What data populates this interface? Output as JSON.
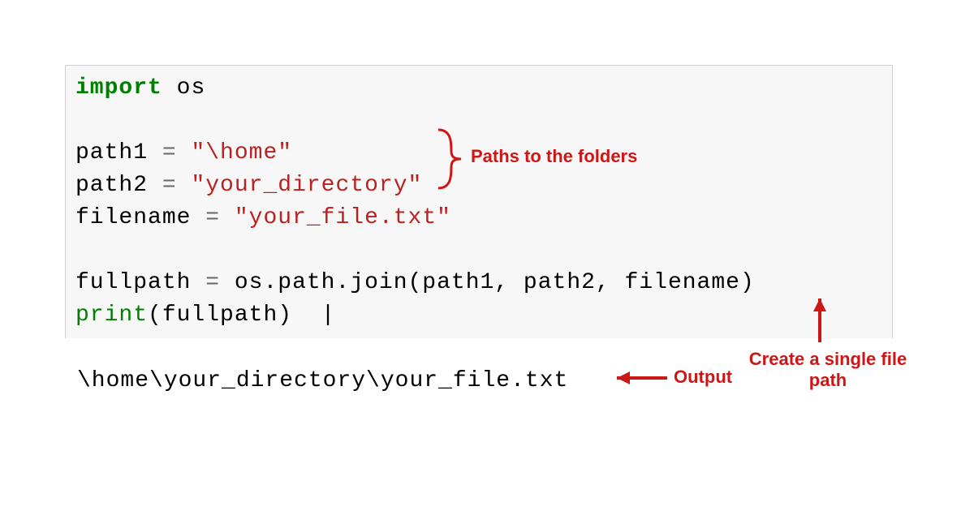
{
  "code": {
    "kw_import": "import",
    "module_os": "os",
    "var_path1": "path1",
    "var_path2": "path2",
    "var_filename": "filename",
    "var_fullpath": "fullpath",
    "eq": "=",
    "str_path1": "\"\\home\"",
    "str_path2": "\"your_directory\"",
    "str_filename": "\"your_file.txt\"",
    "ospathjoin": "os.path.join(path1, path2, filename)",
    "builtin_print": "print",
    "print_args": "(fullpath)",
    "cursor": "|"
  },
  "output": "\\home\\your_directory\\your_file.txt",
  "annotations": {
    "paths_label": "Paths to the folders",
    "output_label": "Output",
    "create_path_label1": "Create a single file",
    "create_path_label2": "path"
  }
}
